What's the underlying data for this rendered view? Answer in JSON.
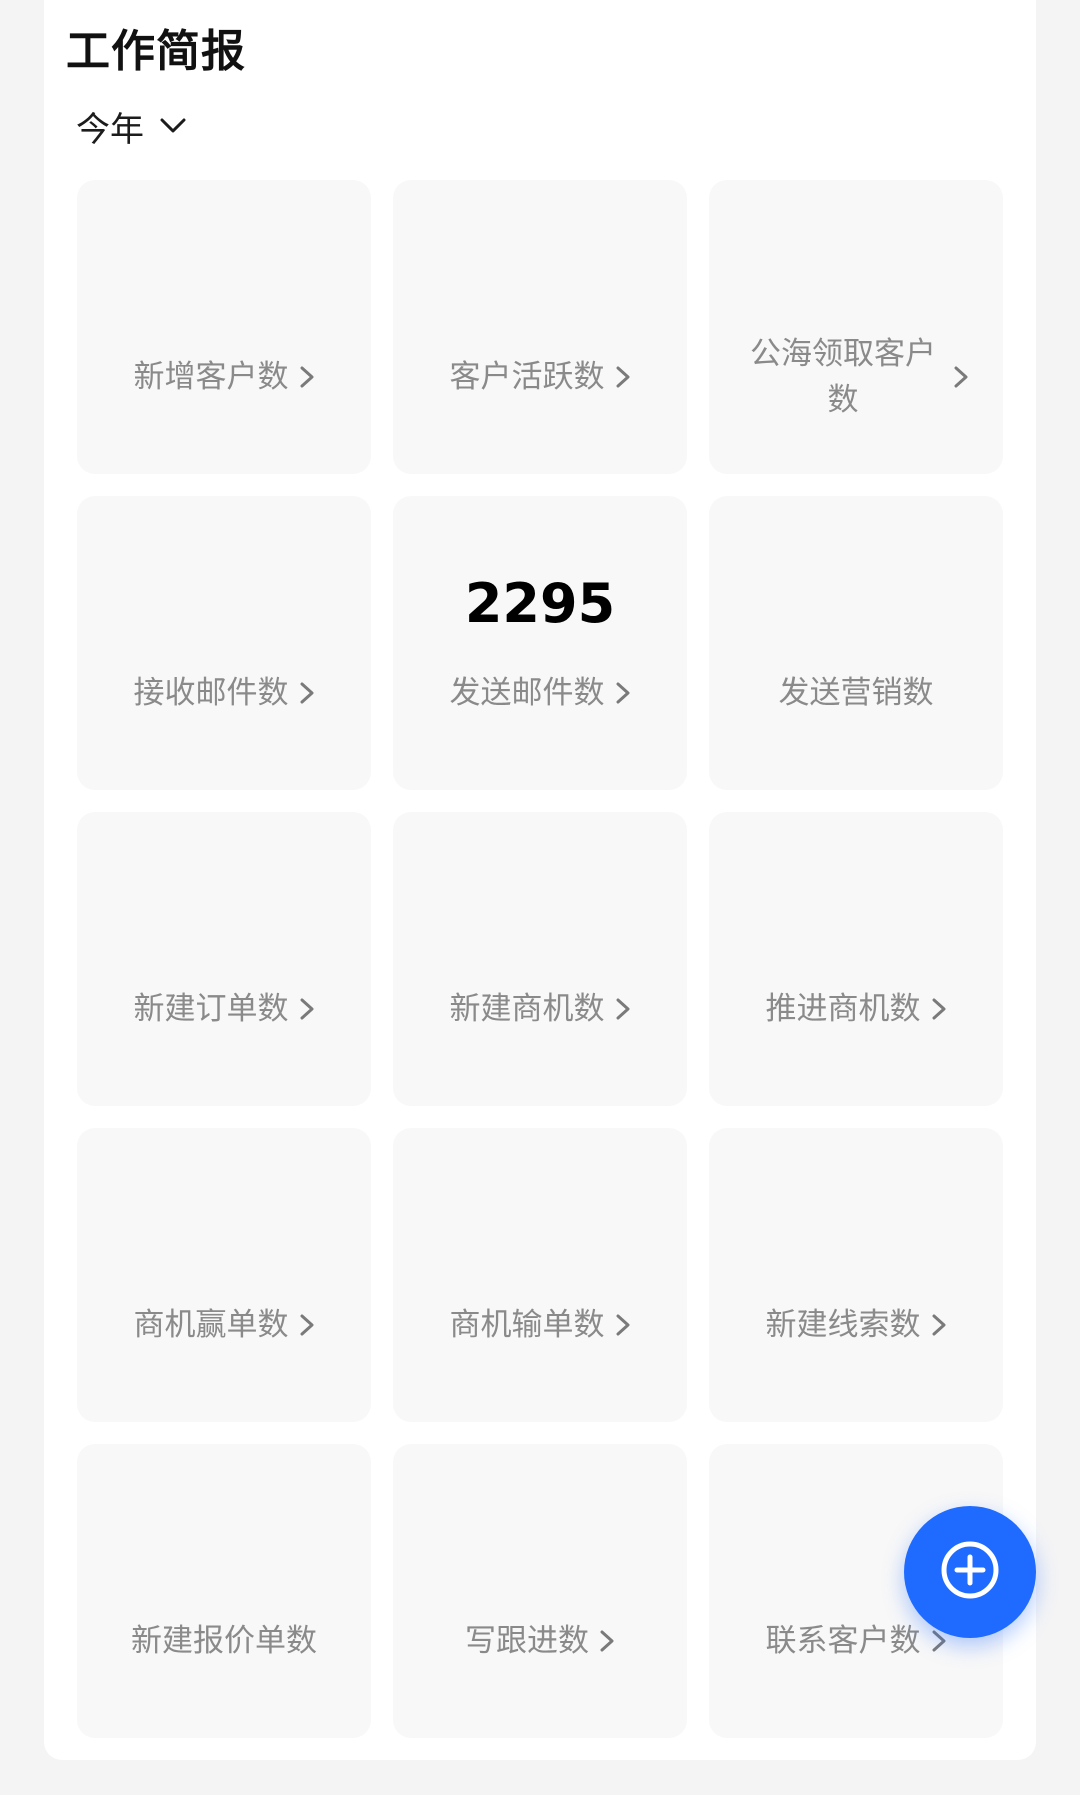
{
  "header": {
    "title": "工作简报",
    "period": "今年"
  },
  "tiles": [
    {
      "label": "新增客户数",
      "value": ""
    },
    {
      "label": "客户活跃数",
      "value": ""
    },
    {
      "label": "公海领取客户数",
      "value": ""
    },
    {
      "label": "接收邮件数",
      "value": ""
    },
    {
      "label": "发送邮件数",
      "value": "2295"
    },
    {
      "label": "发送营销数",
      "value": ""
    },
    {
      "label": "新建订单数",
      "value": ""
    },
    {
      "label": "新建商机数",
      "value": ""
    },
    {
      "label": "推进商机数",
      "value": ""
    },
    {
      "label": "商机赢单数",
      "value": ""
    },
    {
      "label": "商机输单数",
      "value": ""
    },
    {
      "label": "新建线索数",
      "value": ""
    },
    {
      "label": "新建报价单数",
      "value": ""
    },
    {
      "label": "写跟进数",
      "value": ""
    },
    {
      "label": "联系客户数",
      "value": ""
    }
  ],
  "icons": {
    "period_dropdown": "chevron-down-icon",
    "tile_arrow": "chevron-right-icon",
    "fab": "add-circle-icon"
  },
  "colors": {
    "accent": "#1f6bff",
    "tile_background": "#f8f8f8",
    "label": "#8a8a8a"
  }
}
